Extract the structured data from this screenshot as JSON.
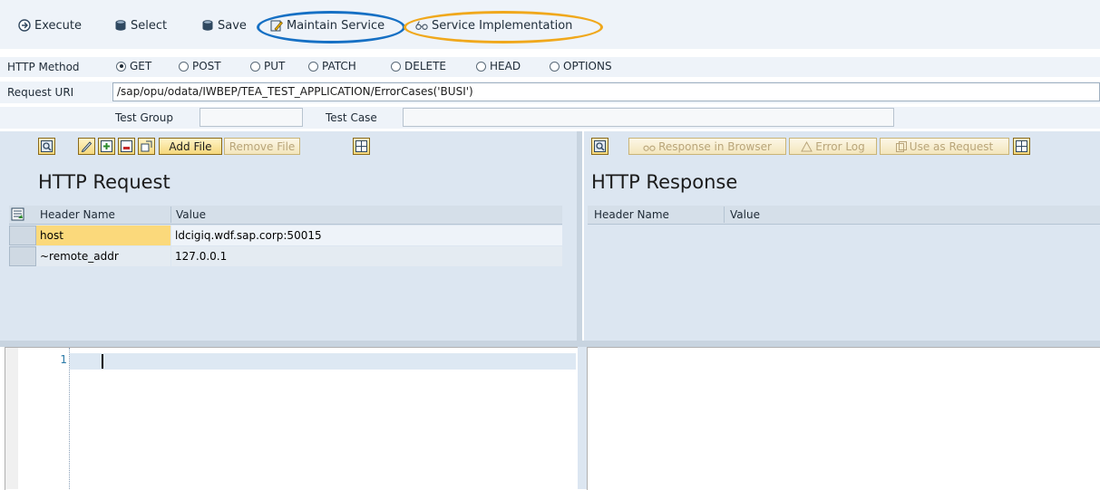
{
  "toolbar": {
    "execute": "Execute",
    "select": "Select",
    "save": "Save",
    "maintain_service": "Maintain Service",
    "service_implementation": "Service Implementation",
    "highlight_colors": {
      "maintain": "#1670c4",
      "service_impl": "#f0a81c"
    }
  },
  "method": {
    "label": "HTTP Method",
    "options": [
      "GET",
      "POST",
      "PUT",
      "PATCH",
      "DELETE",
      "HEAD",
      "OPTIONS"
    ],
    "selected": "GET"
  },
  "uri": {
    "label": "Request URI",
    "value": "/sap/opu/odata/IWBEP/TEA_TEST_APPLICATION/ErrorCases('BUSI')"
  },
  "test": {
    "group_label": "Test Group",
    "group_value": "",
    "case_label": "Test Case",
    "case_value": ""
  },
  "request": {
    "title": "HTTP Request",
    "add_file": "Add File",
    "remove_file": "Remove File",
    "columns": [
      "Header Name",
      "Value"
    ],
    "rows": [
      {
        "name": "host",
        "value": "ldcigiq.wdf.sap.corp:50015"
      },
      {
        "name": "~remote_addr",
        "value": "127.0.0.1"
      }
    ]
  },
  "response": {
    "title": "HTTP Response",
    "response_in_browser": "Response in Browser",
    "error_log": "Error Log",
    "use_as_request": "Use as Request",
    "columns": [
      "Header Name",
      "Value"
    ]
  },
  "editor": {
    "line_number": "1"
  },
  "colors": {
    "toolbar_bg": "#eef3f9",
    "panel_bg": "#dce6f1",
    "button_yellow": "#f5d77c"
  }
}
